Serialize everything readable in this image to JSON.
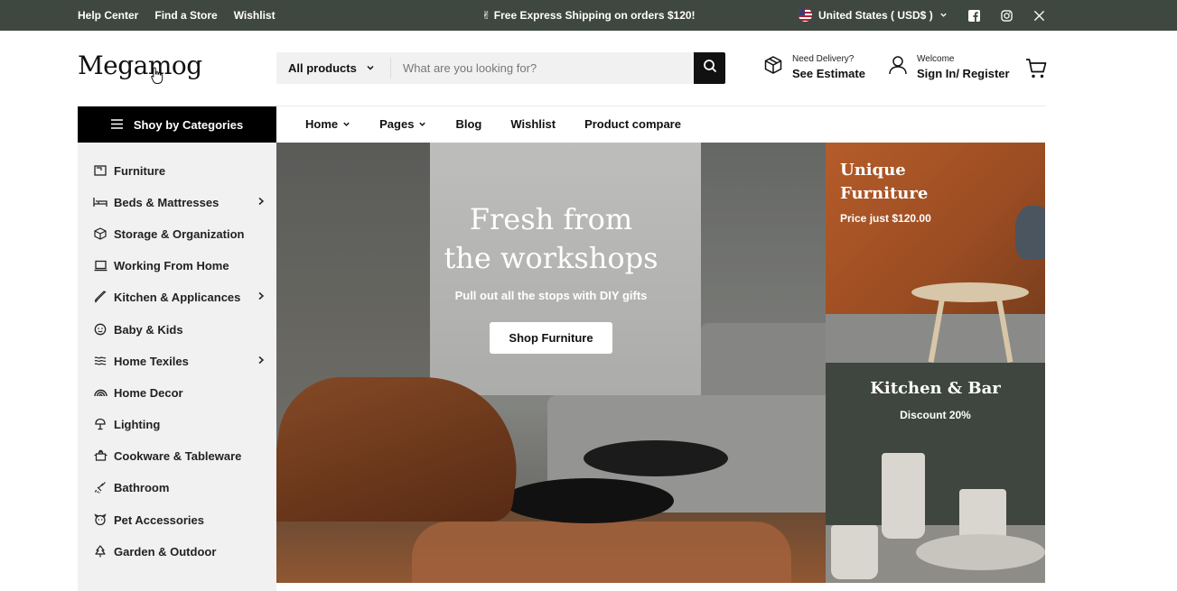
{
  "topbar": {
    "links": [
      "Help Center",
      "Find a Store",
      "Wishlist"
    ],
    "promo": "✌ Free Express Shipping on orders $120!",
    "country": "United States ( USD$ )",
    "socials": [
      "facebook-icon",
      "instagram-icon",
      "x-icon"
    ]
  },
  "header": {
    "logo": "Megamog",
    "search": {
      "category": "All products",
      "placeholder": "What are you looking for?"
    },
    "delivery": {
      "small": "Need Delivery?",
      "big": "See Estimate"
    },
    "account": {
      "small": "Welcome",
      "big": "Sign In/ Register"
    }
  },
  "categories_button": "Shoy by Categories",
  "nav": {
    "items": [
      {
        "label": "Home",
        "has_dropdown": true
      },
      {
        "label": "Pages",
        "has_dropdown": true
      },
      {
        "label": "Blog",
        "has_dropdown": false
      },
      {
        "label": "Wishlist",
        "has_dropdown": false
      },
      {
        "label": "Product compare",
        "has_dropdown": false
      }
    ]
  },
  "sidebar": {
    "items": [
      {
        "label": "Furniture",
        "icon": "furniture-icon",
        "submenu": false
      },
      {
        "label": "Beds & Mattresses",
        "icon": "bed-icon",
        "submenu": true
      },
      {
        "label": "Storage & Organization",
        "icon": "box-icon",
        "submenu": false
      },
      {
        "label": "Working From Home",
        "icon": "laptop-icon",
        "submenu": false
      },
      {
        "label": "Kitchen & Applicances",
        "icon": "knife-icon",
        "submenu": true
      },
      {
        "label": "Baby & Kids",
        "icon": "baby-icon",
        "submenu": false
      },
      {
        "label": "Home Texiles",
        "icon": "waves-icon",
        "submenu": true
      },
      {
        "label": "Home Decor",
        "icon": "rainbow-icon",
        "submenu": false
      },
      {
        "label": "Lighting",
        "icon": "lamp-icon",
        "submenu": false
      },
      {
        "label": "Cookware & Tableware",
        "icon": "pot-icon",
        "submenu": false
      },
      {
        "label": "Bathroom",
        "icon": "shower-icon",
        "submenu": false
      },
      {
        "label": "Pet Accessories",
        "icon": "paw-icon",
        "submenu": false
      },
      {
        "label": "Garden & Outdoor",
        "icon": "tree-icon",
        "submenu": false
      }
    ]
  },
  "hero": {
    "title_line1": "Fresh from",
    "title_line2": "the workshops",
    "subtitle": "Pull out all the stops with DIY gifts",
    "button": "Shop Furniture"
  },
  "promo_unique": {
    "title_line1": "Unique",
    "title_line2": "Furniture",
    "sub_prefix": "Price just ",
    "sub_value": "$120.00"
  },
  "promo_kitchen": {
    "title": "Kitchen & Bar",
    "sub_prefix": "Discount ",
    "sub_value": "20%"
  }
}
